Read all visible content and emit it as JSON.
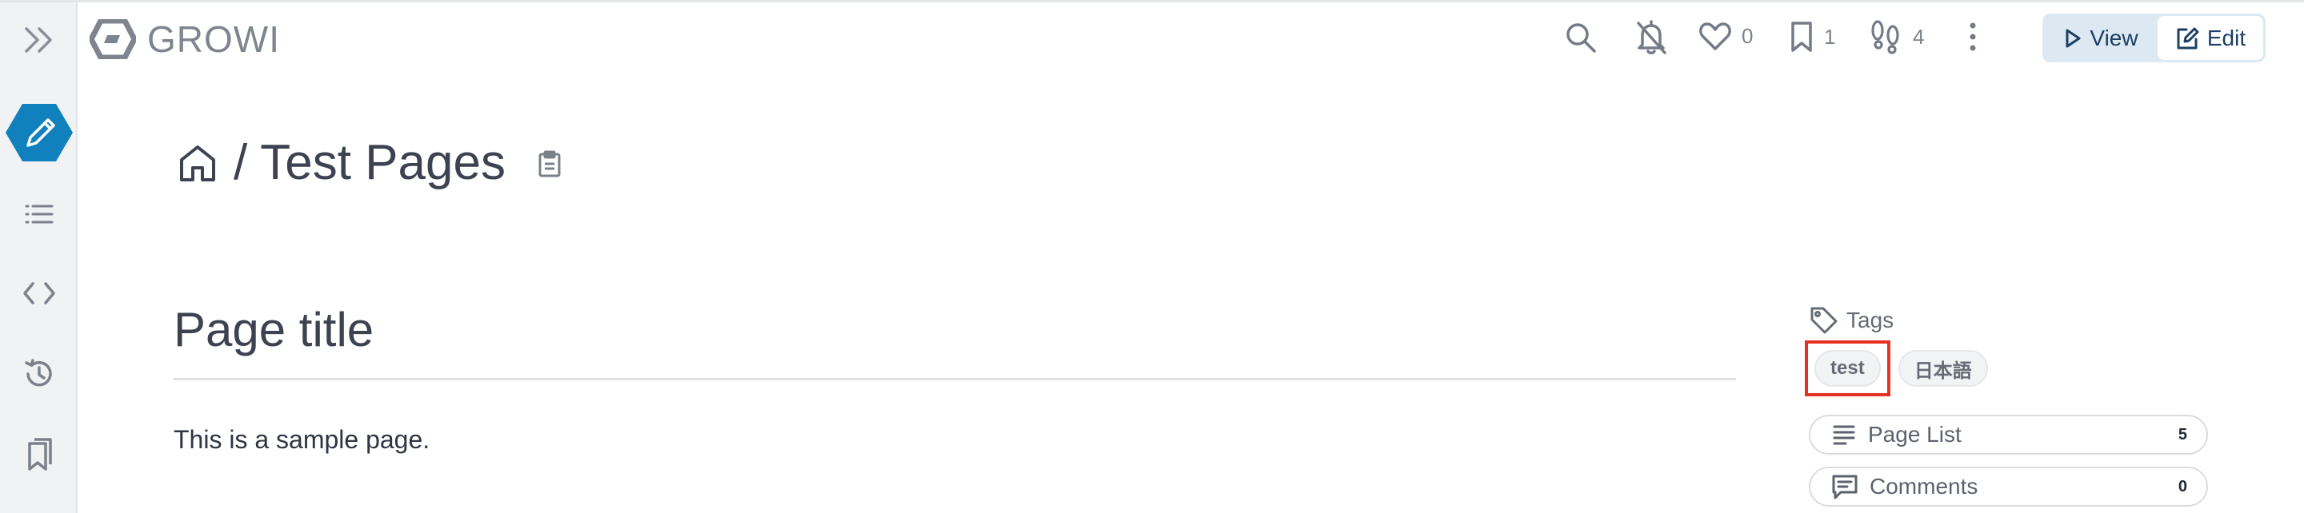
{
  "header": {
    "sidebar_toggle_icon": "double-chevron-right-icon",
    "logo_text": "GROWI",
    "search_icon": "search-icon",
    "notifications_icon": "bell-off-icon",
    "likes_count": "0",
    "bookmarks_count": "1",
    "seen_by_count": "4",
    "more_icon": "kebab-menu-icon",
    "view_label": "View",
    "edit_label": "Edit"
  },
  "sidebar": {
    "items": [
      {
        "icon": "pencil-icon",
        "active": true
      },
      {
        "icon": "list-icon"
      },
      {
        "icon": "code-icon"
      },
      {
        "icon": "history-icon"
      },
      {
        "icon": "bookmarks-icon"
      }
    ]
  },
  "page": {
    "separator": "/",
    "title": "Test Pages",
    "content_heading": "Page title",
    "content_text": "This is a sample page."
  },
  "right_panel": {
    "tags_label": "Tags",
    "tags": [
      "test",
      "日本語"
    ],
    "page_list_label": "Page List",
    "page_list_count": "5",
    "comments_label": "Comments",
    "comments_count": "0"
  },
  "colors": {
    "accent": "#1181be",
    "highlight": "#e53323",
    "sidebar_bg": "#f1f2f3",
    "edit_group_bg": "#dce9f3"
  }
}
